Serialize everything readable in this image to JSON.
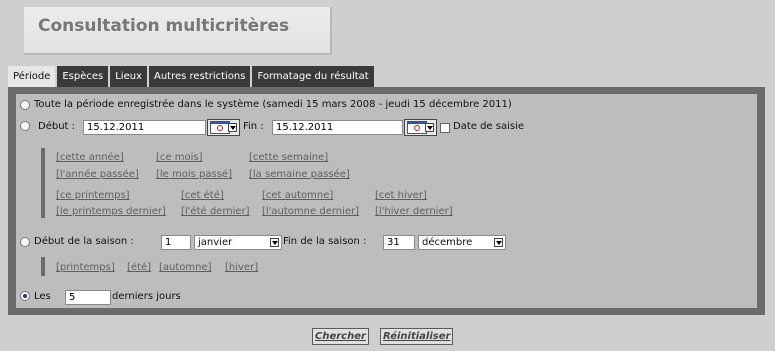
{
  "page": {
    "title": "Consultation multicritères"
  },
  "tabs": [
    {
      "label": "Période",
      "active": true
    },
    {
      "label": "Espèces"
    },
    {
      "label": "Lieux"
    },
    {
      "label": "Autres restrictions"
    },
    {
      "label": "Formatage du résultat"
    }
  ],
  "periode": {
    "all_label": "Toute la période enregistrée dans le système (samedi 15 mars 2008 - jeudi 15 décembre 2011)",
    "debut_label": "Début :",
    "debut_value": "15.12.2011",
    "fin_label": "Fin :",
    "fin_value": "15.12.2011",
    "date_saisie_label": "Date de saisie",
    "quick_links_row1": [
      "[cette année]",
      "[ce mois]",
      "[cette semaine]"
    ],
    "quick_links_row2": [
      "[l'année passée]",
      "[le mois passé]",
      "[la semaine passée]"
    ],
    "season_links_row1": [
      "[ce printemps]",
      "[cet été]",
      "[cet automne]",
      "[cet hiver]"
    ],
    "season_links_row2": [
      "[le printemps dernier]",
      "[l'été dernier]",
      "[l'automne dernier]",
      "[l'hiver dernier]"
    ],
    "saison_debut_label": "Début de la saison :",
    "saison_debut_day": "1",
    "saison_debut_month": "janvier",
    "saison_fin_label": "Fin de la saison :",
    "saison_fin_day": "31",
    "saison_fin_month": "décembre",
    "saison_links": [
      "[printemps]",
      "[été]",
      "[automne]",
      "[hiver]"
    ],
    "les_label": "Les",
    "les_value": "5",
    "derniers_jours_label": "derniers jours",
    "selected_option": "les-derniers-jours"
  },
  "actions": {
    "search_label": "Chercher",
    "reset_label": "Réinitialiser"
  }
}
